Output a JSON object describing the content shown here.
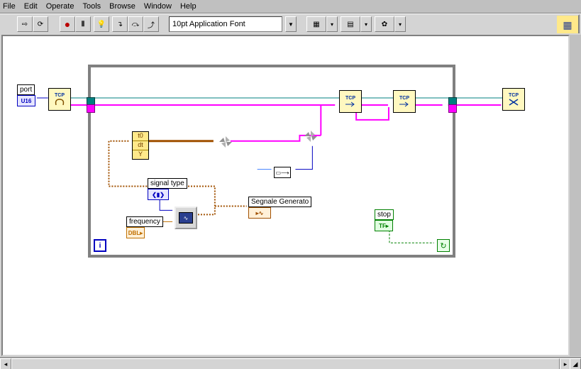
{
  "menu": {
    "file": "File",
    "edit": "Edit",
    "operate": "Operate",
    "tools": "Tools",
    "browse": "Browse",
    "window": "Window",
    "help": "Help"
  },
  "toolbar": {
    "font": "10pt Application Font"
  },
  "controls": {
    "port": {
      "label": "port",
      "term": "U16"
    },
    "signal": {
      "label": "signal type",
      "term": "❮▮❯"
    },
    "frequency": {
      "label": "frequency",
      "term": "DBL"
    },
    "segnale": {
      "label": "Segnale Generato",
      "term": "∿"
    },
    "stop": {
      "label": "stop",
      "term": "TF"
    }
  },
  "builder": {
    "r0": "t0",
    "r1": "dt",
    "r2": "Y"
  },
  "tcp_label": "TCP",
  "loop": {
    "iter": "i",
    "cond": "↻"
  }
}
